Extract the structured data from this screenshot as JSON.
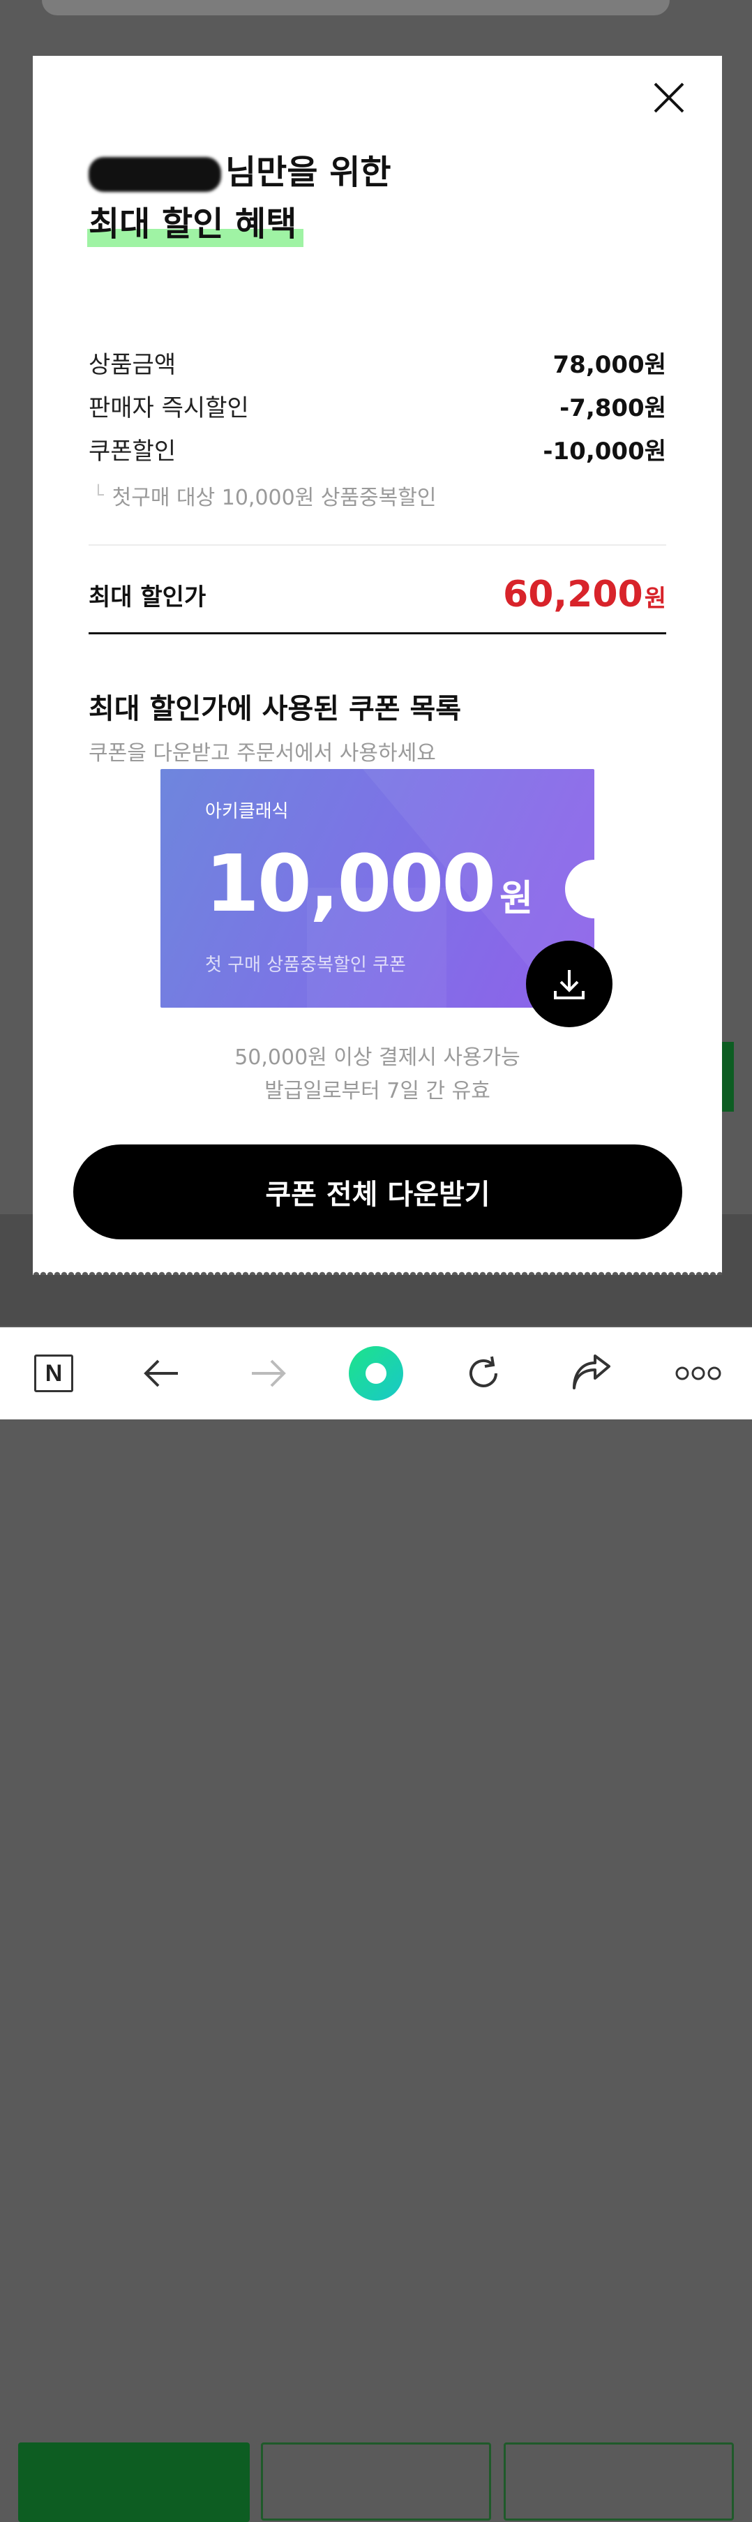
{
  "modal": {
    "title_suffix": "님만을 위한",
    "title_line2": "최대 할인 혜택",
    "price_rows": [
      {
        "label": "상품금액",
        "value": "78,000원"
      },
      {
        "label": "판매자 즉시할인",
        "value": "-7,800원"
      },
      {
        "label": "쿠폰할인",
        "value": "-10,000원"
      }
    ],
    "coupon_note": "첫구매 대상 10,000원 상품중복할인",
    "total": {
      "label": "최대 할인가",
      "amount": "60,200",
      "unit": "원"
    },
    "coupon_section": {
      "title": "최대 할인가에 사용된 쿠폰 목록",
      "subtitle": "쿠폰을 다운받고 주문서에서 사용하세요"
    },
    "coupon": {
      "brand": "아키클래식",
      "amount": "10,000",
      "unit": "원",
      "description": "첫 구매 상품중복할인 쿠폰",
      "condition_1": "50,000원 이상 결제시 사용가능",
      "condition_2": "발급일로부터 7일 간 유효"
    },
    "download_all_label": "쿠폰 전체 다운받기",
    "icons": {
      "close": "close-icon",
      "download": "download-icon"
    }
  },
  "colors": {
    "accent_red": "#d8232a",
    "highlight_green": "#9ff3a4",
    "coupon_gradient_start": "#6e86dd",
    "coupon_gradient_end": "#8f61ea"
  },
  "browser_bar": {
    "logo_letter": "N",
    "icons": [
      "naver-logo-icon",
      "back-arrow-icon",
      "forward-arrow-icon",
      "green-circle-icon",
      "refresh-icon",
      "share-icon",
      "more-icon"
    ]
  }
}
